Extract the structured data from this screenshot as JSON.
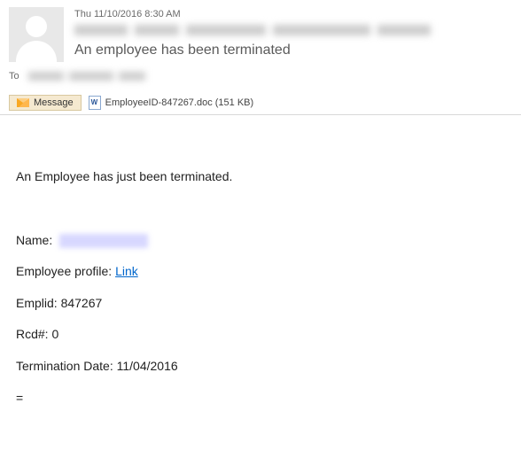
{
  "header": {
    "timestamp": "Thu 11/10/2016 8:30 AM",
    "subject": "An employee has been terminated"
  },
  "to": {
    "label": "To"
  },
  "tabs": {
    "message_label": "Message"
  },
  "attachment": {
    "filename": "EmployeeID-847267.doc (151 KB)"
  },
  "body": {
    "intro": "An Employee has just been terminated.",
    "name_label": "Name:",
    "profile_label": "Employee profile: ",
    "profile_link": "Link",
    "emplid_label": "Emplid: ",
    "emplid_value": "847267",
    "rcd_label": "Rcd#: ",
    "rcd_value": "0",
    "termdate_label": "Termination Date: ",
    "termdate_value": "11/04/2016",
    "footer": "="
  }
}
